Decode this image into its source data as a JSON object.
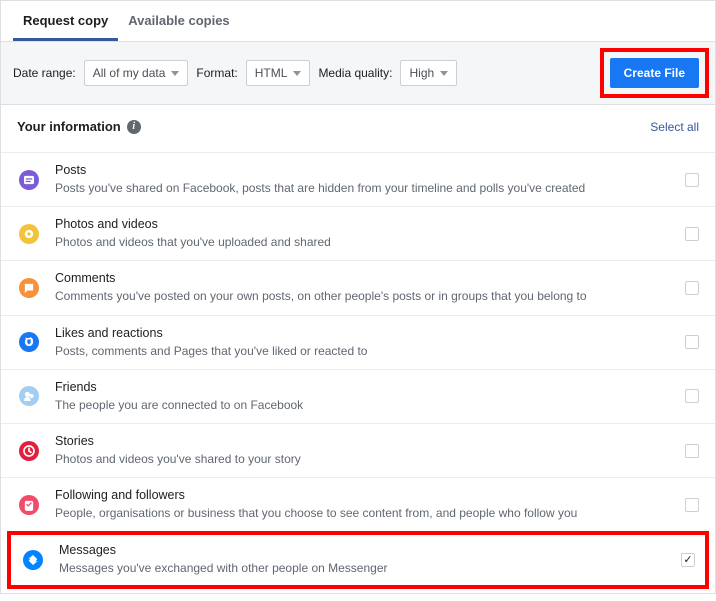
{
  "tabs": {
    "request": "Request copy",
    "available": "Available copies"
  },
  "filters": {
    "date_label": "Date range:",
    "date_value": "All of my data",
    "format_label": "Format:",
    "format_value": "HTML",
    "media_label": "Media quality:",
    "media_value": "High",
    "create": "Create File"
  },
  "section": {
    "title": "Your information",
    "select_all": "Select all"
  },
  "items": [
    {
      "title": "Posts",
      "desc": "Posts you've shared on Facebook, posts that are hidden from your timeline and polls you've created",
      "color": "#7b5cd6",
      "checked": false
    },
    {
      "title": "Photos and videos",
      "desc": "Photos and videos that you've uploaded and shared",
      "color": "#f5c33b",
      "checked": false
    },
    {
      "title": "Comments",
      "desc": "Comments you've posted on your own posts, on other people's posts or in groups that you belong to",
      "color": "#f7923b",
      "checked": false
    },
    {
      "title": "Likes and reactions",
      "desc": "Posts, comments and Pages that you've liked or reacted to",
      "color": "#1877f2",
      "checked": false
    },
    {
      "title": "Friends",
      "desc": "The people you are connected to on Facebook",
      "color": "#a3cef1",
      "checked": false
    },
    {
      "title": "Stories",
      "desc": "Photos and videos you've shared to your story",
      "color": "#e41e3f",
      "checked": false
    },
    {
      "title": "Following and followers",
      "desc": "People, organisations or business that you choose to see content from, and people who follow you",
      "color": "#f24b6a",
      "checked": false
    },
    {
      "title": "Messages",
      "desc": "Messages you've exchanged with other people on Messenger",
      "color": "#0084ff",
      "checked": true
    }
  ]
}
